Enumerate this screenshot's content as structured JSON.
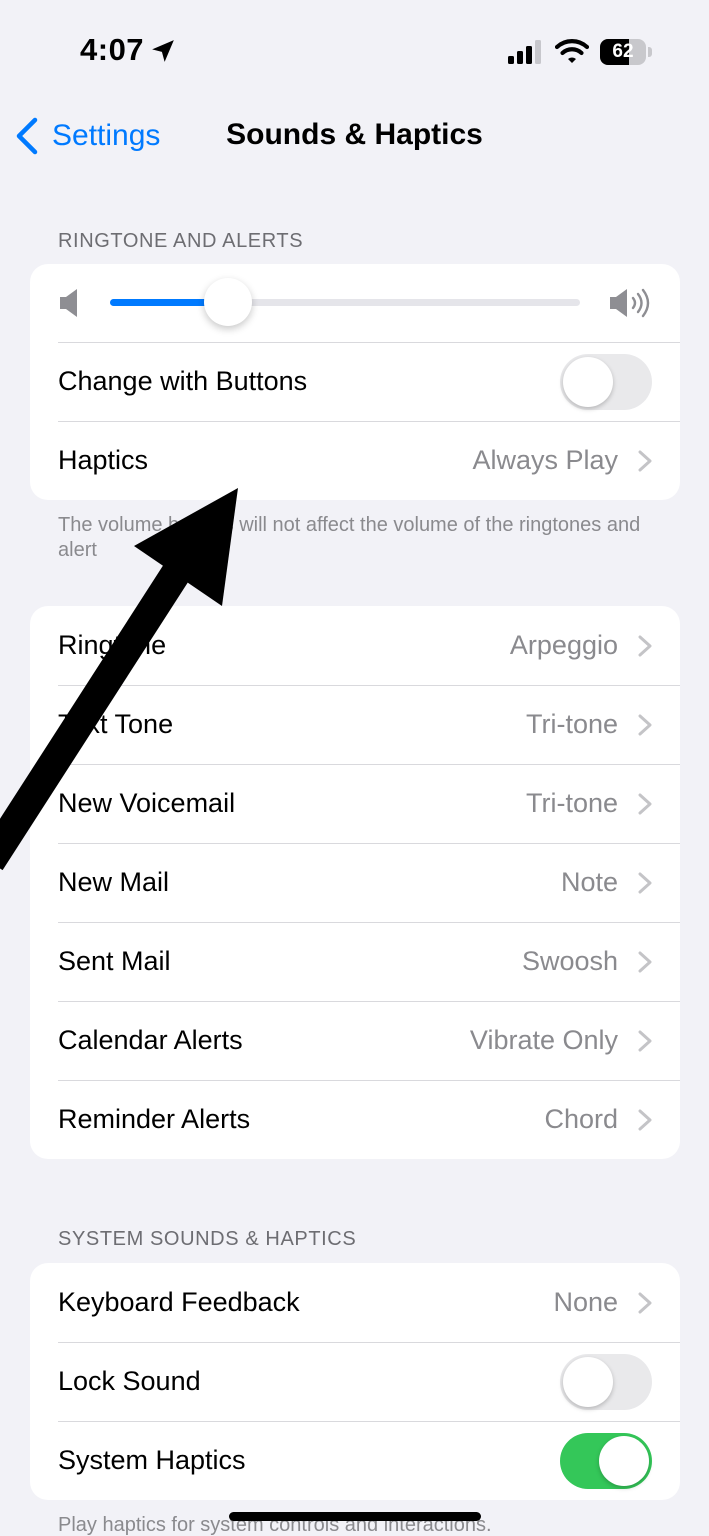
{
  "status_bar": {
    "time": "4:07",
    "battery_percent": 62,
    "battery_label": "62",
    "icons": [
      "location-arrow-icon",
      "cellular-signal-icon",
      "wifi-icon",
      "battery-icon"
    ]
  },
  "nav": {
    "back_label": "Settings",
    "title": "Sounds & Haptics"
  },
  "ringtone_section": {
    "header": "RINGTONE AND ALERTS",
    "volume_level": 0.25,
    "change_with_buttons_label": "Change with Buttons",
    "change_with_buttons_on": false,
    "haptics_label": "Haptics",
    "haptics_value": "Always Play",
    "footer": "The volume buttons will not affect the volume of the ringtones and alert"
  },
  "sounds": [
    {
      "label": "Ringtone",
      "value": "Arpeggio"
    },
    {
      "label": "Text Tone",
      "value": "Tri-tone"
    },
    {
      "label": "New Voicemail",
      "value": "Tri-tone"
    },
    {
      "label": "New Mail",
      "value": "Note"
    },
    {
      "label": "Sent Mail",
      "value": "Swoosh"
    },
    {
      "label": "Calendar Alerts",
      "value": "Vibrate Only"
    },
    {
      "label": "Reminder Alerts",
      "value": "Chord"
    }
  ],
  "system_section": {
    "header": "SYSTEM SOUNDS & HAPTICS",
    "keyboard_feedback_label": "Keyboard Feedback",
    "keyboard_feedback_value": "None",
    "lock_sound_label": "Lock Sound",
    "lock_sound_on": false,
    "system_haptics_label": "System Haptics",
    "system_haptics_on": true,
    "footer": "Play haptics for system controls and interactions."
  },
  "colors": {
    "accent": "#007aff",
    "toggle_on": "#34c759",
    "background": "#f2f2f7"
  }
}
